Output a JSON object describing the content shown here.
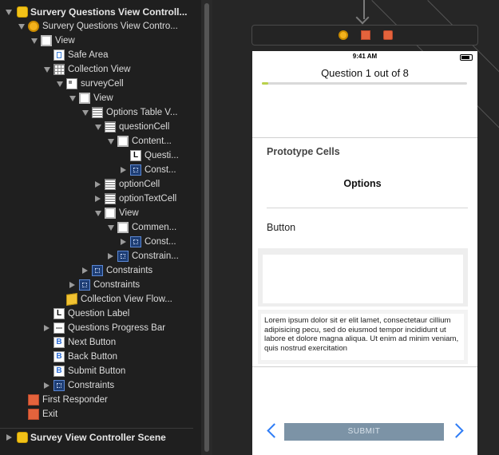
{
  "outline": {
    "scene_title": "Survery Questions View Controll...",
    "items": [
      {
        "label": "Survery Questions View Contro...",
        "icon": "view-controller-icon"
      },
      {
        "label": "View",
        "icon": "view-icon"
      },
      {
        "label": "Safe Area",
        "icon": "safe-area-icon"
      },
      {
        "label": "Collection View",
        "icon": "collection-view-icon"
      },
      {
        "label": "surveyCell",
        "icon": "collection-cell-icon"
      },
      {
        "label": "View",
        "icon": "view-icon"
      },
      {
        "label": "Options Table V...",
        "icon": "table-view-icon"
      },
      {
        "label": "questionCell",
        "icon": "table-cell-icon"
      },
      {
        "label": "Content...",
        "icon": "view-icon"
      },
      {
        "label": "Questi...",
        "icon": "label-icon"
      },
      {
        "label": "Const...",
        "icon": "constraints-icon"
      },
      {
        "label": "optionCell",
        "icon": "table-cell-icon"
      },
      {
        "label": "optionTextCell",
        "icon": "table-cell-icon"
      },
      {
        "label": "View",
        "icon": "view-icon"
      },
      {
        "label": "Commen...",
        "icon": "view-icon"
      },
      {
        "label": "Const...",
        "icon": "constraints-icon"
      },
      {
        "label": "Constrain...",
        "icon": "constraints-icon"
      },
      {
        "label": "Constraints",
        "icon": "constraints-icon"
      },
      {
        "label": "Constraints",
        "icon": "constraints-icon"
      },
      {
        "label": "Collection View Flow...",
        "icon": "flow-layout-icon"
      },
      {
        "label": "Question Label",
        "icon": "label-icon"
      },
      {
        "label": "Questions Progress Bar",
        "icon": "progress-bar-icon"
      },
      {
        "label": "Next Button",
        "icon": "button-icon"
      },
      {
        "label": "Back Button",
        "icon": "button-icon"
      },
      {
        "label": "Submit Button",
        "icon": "button-icon"
      },
      {
        "label": "Constraints",
        "icon": "constraints-icon"
      },
      {
        "label": "First Responder",
        "icon": "first-responder-icon"
      },
      {
        "label": "Exit",
        "icon": "exit-icon"
      }
    ],
    "second_scene_title": "Survey View Controller Scene"
  },
  "device": {
    "status_time": "9:41 AM",
    "question_label": "Question 1 out of 8",
    "progress": 0.03,
    "prototype_header": "Prototype Cells",
    "options_label": "Options",
    "option_button_label": "Button",
    "comment_text": "Lorem ipsum dolor sit er elit lamet, consectetaur cillium adipisicing pecu, sed do eiusmod tempor incididunt ut labore et dolore magna aliqua. Ut enim ad minim veniam, quis nostrud exercitation",
    "submit_label": "SUBMIT"
  },
  "colors": {
    "accent_blue": "#2f7df6",
    "submit_bg": "#7c93a6",
    "progress_fill": "#b9d14a"
  }
}
